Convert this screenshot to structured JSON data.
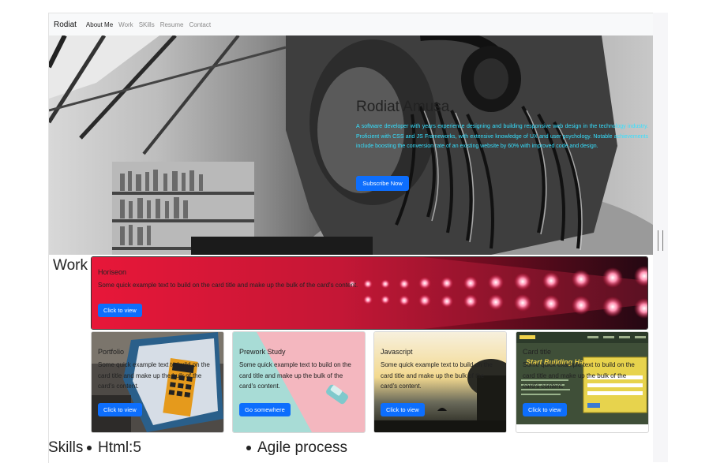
{
  "navbar": {
    "brand": "Rodiat",
    "links": [
      "About Me",
      "Work",
      "SKills",
      "Resume",
      "Contact"
    ]
  },
  "hero": {
    "title": "Rodiat Amusa",
    "text": "A software developer with years experience designing and building responsive web design in the technology industry. Proficient with CSS and JS Frameworks, with extensive knowledge of UX and user psychology. Notable achievements include boosting the conversion rate of an existing website by 60% with improved code and design.",
    "button": "Subscribe Now"
  },
  "work": {
    "heading": "Work",
    "featured": {
      "title": "Horiseon",
      "text": "Some quick example text to build on the card title and make up the bulk of the card's content.",
      "button": "Click to view"
    },
    "cards": [
      {
        "title": "Portfolio",
        "text": "Some quick example text to build on the card title and make up the bulk of the card's content.",
        "button": "Click to view"
      },
      {
        "title": "Prework Study",
        "text": "Some quick example text to build on the card title and make up the bulk of the card's content.",
        "button": "Go somewhere"
      },
      {
        "title": "Javascript",
        "text": "Some quick example text to build on the card title and make up the bulk of the card's content.",
        "button": "Click to view"
      },
      {
        "title": "Card title",
        "text": "Some quick example text to build on the card title and make up the bulk of the card's content.",
        "button": "Click to view",
        "overlay": "Run Buddy",
        "overlay_sub": "Start Building Habits"
      }
    ]
  },
  "skills": {
    "heading": "Skills",
    "items": [
      "Html:5",
      "Agile process"
    ]
  },
  "colors": {
    "primary": "#0d6efd",
    "hero_text": "#35e0ff"
  }
}
